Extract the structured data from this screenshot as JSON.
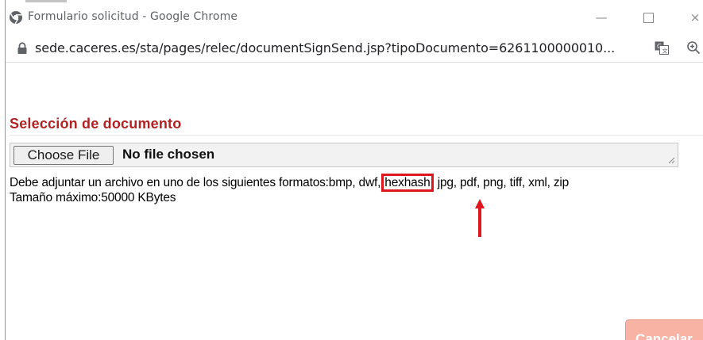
{
  "window": {
    "title": "Formulario solicitud - Google Chrome",
    "controls": {
      "minimize": "—",
      "maximize": "",
      "close": "×"
    }
  },
  "addressbar": {
    "url": "sede.caceres.es/sta/pages/relec/documentSignSend.jsp?tipoDocumento=6261100000010..."
  },
  "main": {
    "section_title": "Selección de documento",
    "file_input": {
      "button_label": "Choose File",
      "status": "No file chosen"
    },
    "formats_line": {
      "prefix": "Debe adjuntar un archivo en uno de los siguientes formatos:bmp, dwf, ",
      "highlighted": "hexhash",
      "suffix": ", jpg, pdf, png, tiff, xml, zip"
    },
    "max_size": "Tamaño máximo:50000 KBytes",
    "cancel_button": "Cancelar"
  },
  "colors": {
    "section_title": "#b22222",
    "highlight": "#e0161e",
    "cancel_button_bg": "#f8b3a4"
  }
}
